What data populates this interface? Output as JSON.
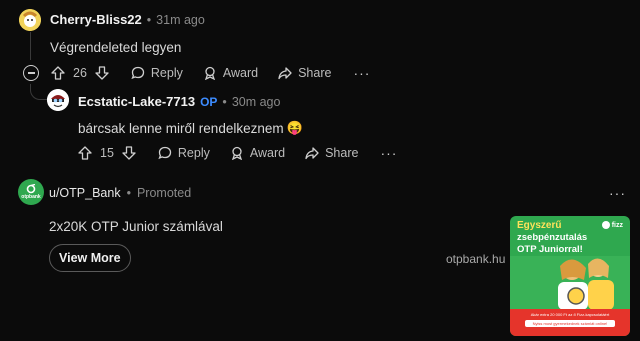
{
  "comment1": {
    "username": "Cherry-Bliss22",
    "time": "31m ago",
    "text": "Végrendeleted legyen",
    "votes": "26",
    "reply_label": "Reply",
    "award_label": "Award",
    "share_label": "Share"
  },
  "comment2": {
    "username": "Ecstatic-Lake-7713",
    "op_badge": "OP",
    "time": "30m ago",
    "text": "bárcsak lenne miről rendelkeznem",
    "emoji": "😝",
    "votes": "15",
    "reply_label": "Reply",
    "award_label": "Award",
    "share_label": "Share"
  },
  "promo": {
    "advertiser": "u/OTP_Bank",
    "tag": "Promoted",
    "logo_text": "otpbank",
    "headline": "2x20K OTP Junior számlával",
    "cta_label": "View More",
    "domain": "otpbank.hu",
    "card": {
      "line1": "Egyszerű",
      "line2": "zsebpénzutalás",
      "line3": "OTP Juniorral!",
      "brand": "fizz",
      "fine1": "Akár extra 20 000 Ft az ő Fizz-kapcsolatáért",
      "fine2": "Nyiss most gyermekednek számlát online!"
    }
  },
  "colors": {
    "background": "#0b0b0b",
    "op": "#3d8cff",
    "otp_green": "#2fa84f",
    "card_red": "#e5342b"
  }
}
